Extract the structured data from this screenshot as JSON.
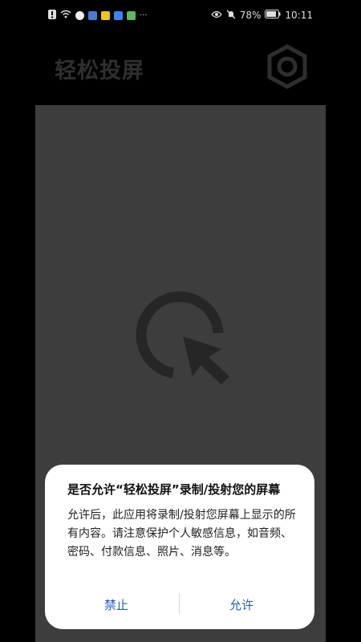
{
  "status_bar": {
    "battery": "78%",
    "time": "10:11",
    "icons": [
      "alert-icon",
      "wifi-icon",
      "app-icon-1",
      "app-icon-2",
      "app-icon-3",
      "app-icon-4",
      "app-icon-5",
      "more-icon",
      "eye-icon",
      "mute-icon",
      "battery-icon"
    ],
    "more": "···"
  },
  "app": {
    "title": "轻松投屏",
    "settings_icon": "gear-icon",
    "center_icon": "cast-cursor-icon"
  },
  "dialog": {
    "title": "是否允许“轻松投屏”录制/投射您的屏幕",
    "body": "允许后，此应用将录制/投射您屏幕上显示的所有内容。请注意保护个人敏感信息，如音频、密码、付款信息、照片、消息等。",
    "deny_label": "禁止",
    "allow_label": "允许"
  },
  "colors": {
    "accent": "#2560c4",
    "panel": "#3d3d3d",
    "background": "#000000",
    "icon": "#2a2a2a"
  }
}
